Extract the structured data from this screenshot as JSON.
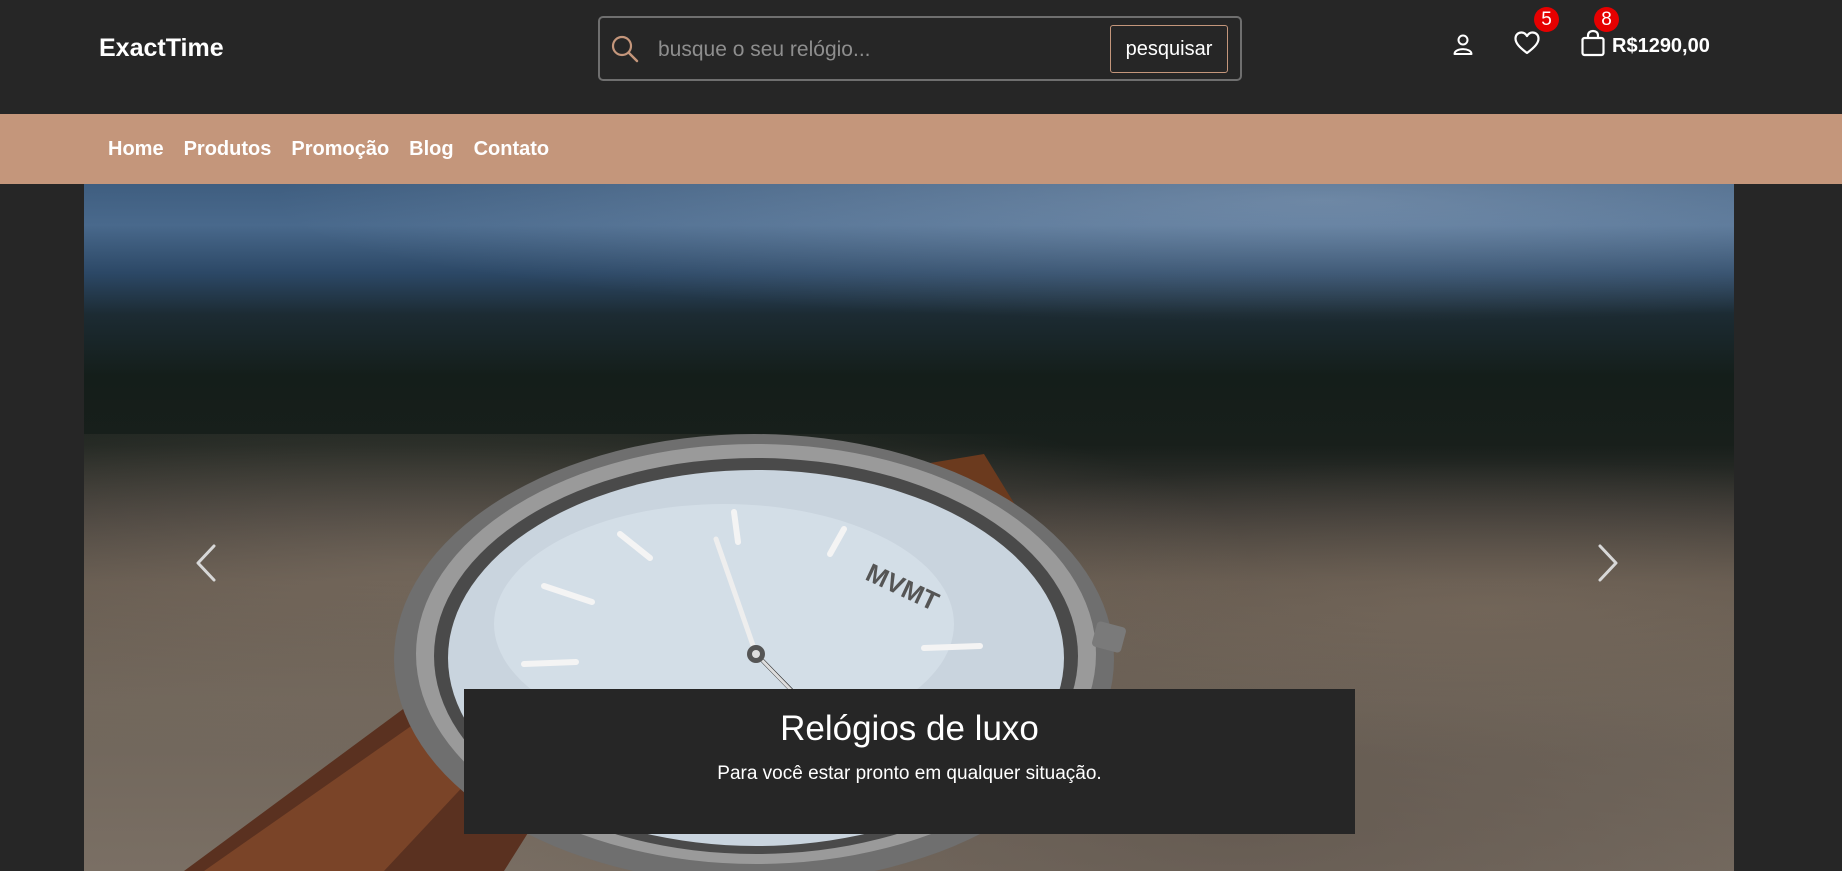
{
  "header": {
    "brand": "ExactTime",
    "search": {
      "placeholder": "busque o seu relógio...",
      "value": "",
      "button_label": "pesquisar"
    },
    "wishlist_count": "5",
    "cart_count": "8",
    "cart_total": "R$1290,00",
    "icons": [
      "search-icon",
      "user-icon",
      "heart-icon",
      "shopping-bag-icon"
    ]
  },
  "nav": {
    "items": [
      {
        "label": "Home"
      },
      {
        "label": "Produtos"
      },
      {
        "label": "Promoção"
      },
      {
        "label": "Blog"
      },
      {
        "label": "Contato"
      }
    ]
  },
  "hero": {
    "watch_brand": "MVMT",
    "title": "Relógios de luxo",
    "subtitle": "Para você estar pronto em qualquer situação."
  },
  "colors": {
    "background": "#262626",
    "accent": "#c4967b",
    "badge": "#e60000"
  }
}
